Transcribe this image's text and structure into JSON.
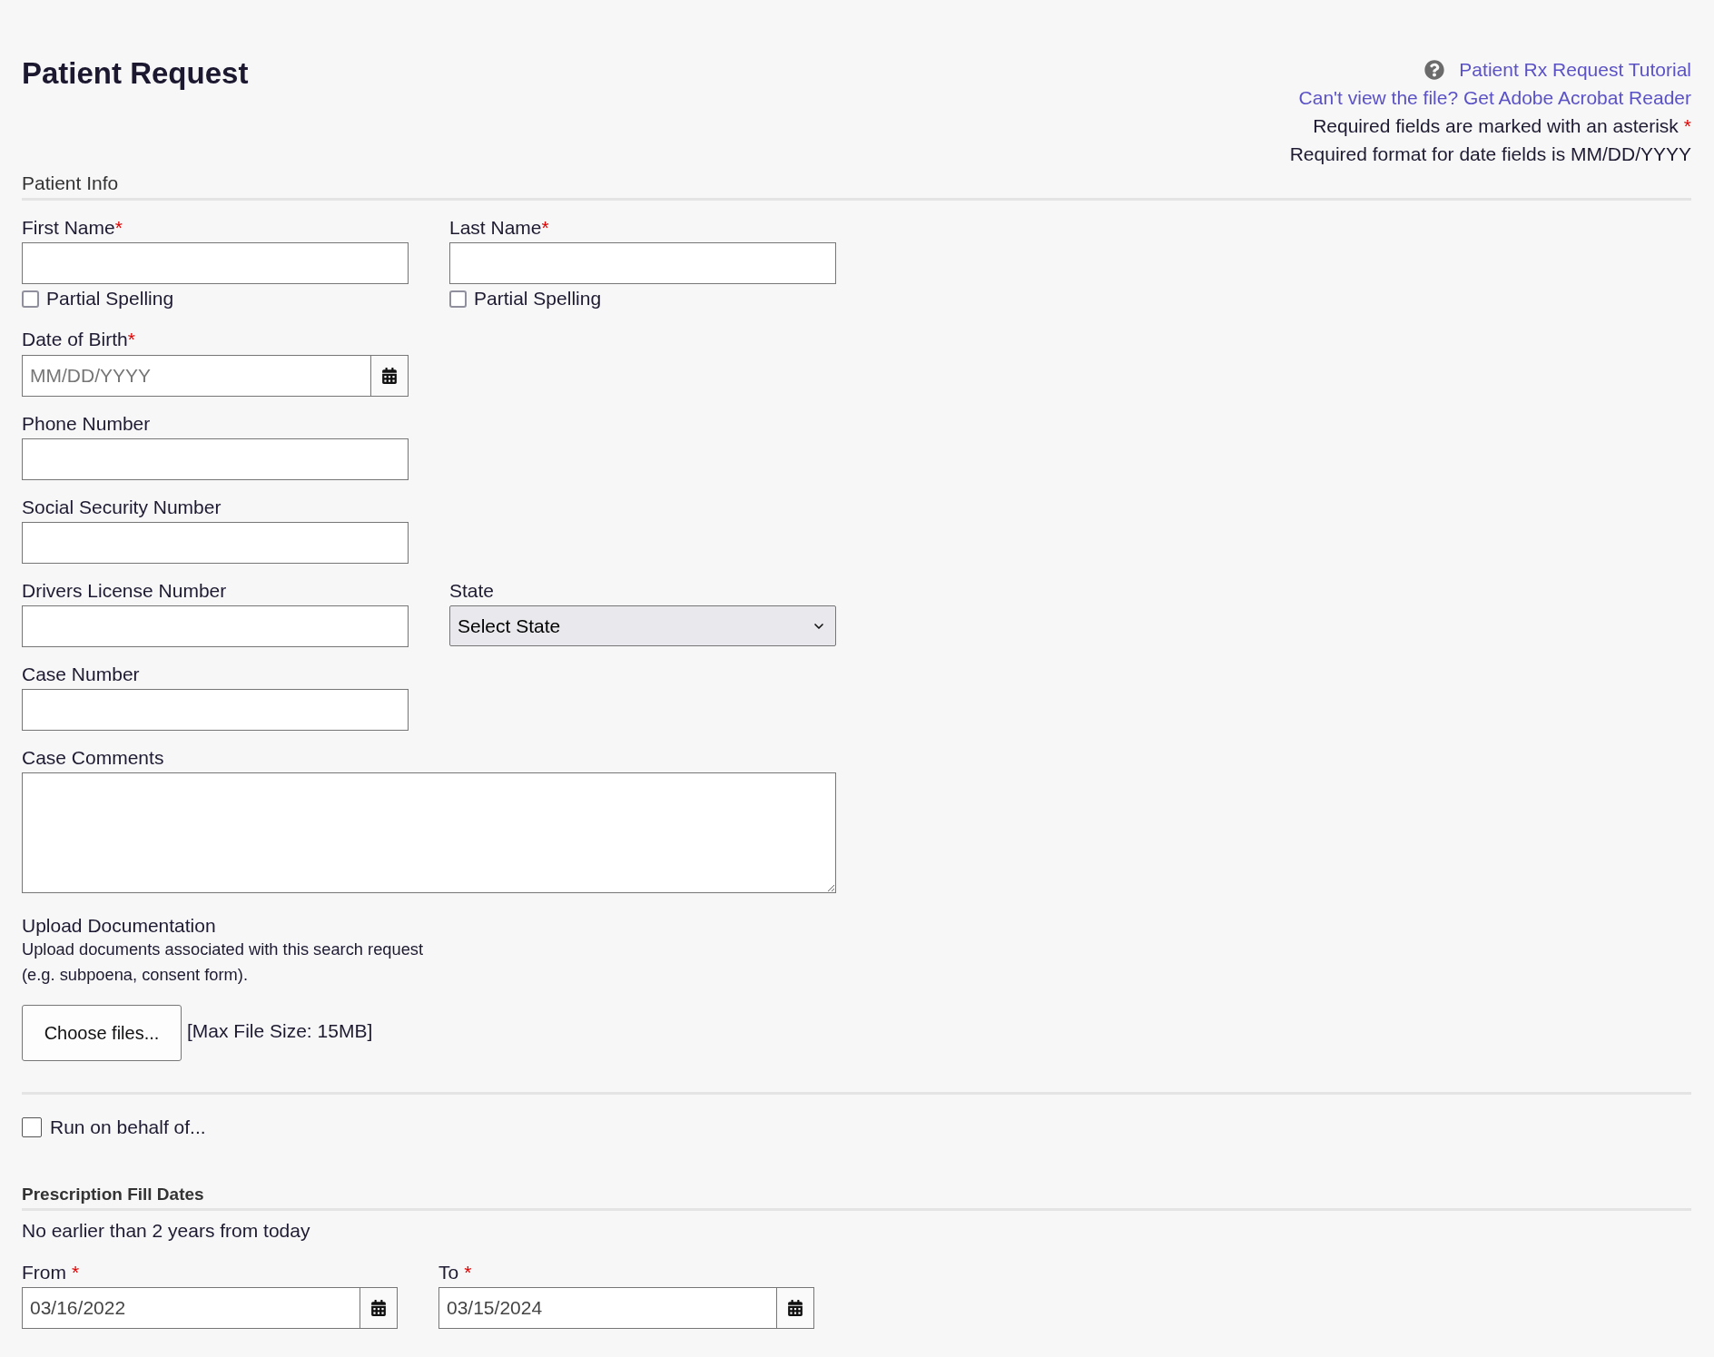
{
  "page_title": "Patient Request",
  "header_links": [
    {
      "text": "Patient Rx Request Tutorial",
      "help_icon": true
    },
    {
      "text": "Can't view the file? Get Adobe Acrobat Reader",
      "help_icon": false
    }
  ],
  "header_notes": [
    {
      "text": "Required fields are marked with an asterisk",
      "required_mark": "*"
    },
    {
      "text": "Required format for date fields is MM/DD/YYYY"
    }
  ],
  "patient_info": {
    "title": "Patient Info",
    "rows": [
      {
        "fields": [
          {
            "kind": "text",
            "label": "First Name",
            "required_mark": "*",
            "partial_spelling": {
              "label": "Partial Spelling",
              "checked": false
            }
          },
          {
            "kind": "text",
            "label": "Last Name",
            "required_mark": "*",
            "partial_spelling": {
              "label": "Partial Spelling",
              "checked": false
            }
          }
        ]
      },
      {
        "fields": [
          {
            "kind": "date",
            "label": "Date of Birth",
            "required_mark": "*",
            "placeholder": "MM/DD/YYYY"
          }
        ]
      },
      {
        "fields": [
          {
            "kind": "text",
            "label": "Phone Number"
          }
        ]
      },
      {
        "fields": [
          {
            "kind": "text",
            "label": "Social Security Number"
          }
        ]
      },
      {
        "fields": [
          {
            "kind": "text",
            "label": "Drivers License Number"
          },
          {
            "kind": "select",
            "label": "State",
            "value": "Select State"
          }
        ]
      },
      {
        "fields": [
          {
            "kind": "text",
            "label": "Case Number"
          }
        ]
      },
      {
        "fields": [
          {
            "kind": "textarea",
            "label": "Case Comments"
          }
        ]
      }
    ]
  },
  "upload": {
    "title": "Upload Documentation",
    "description": "Upload documents associated with this search request (e.g. subpoena, consent form).",
    "button": "Choose files...",
    "max_size": "[Max File Size: 15MB]"
  },
  "run_on_behalf": {
    "label": "Run on behalf of...",
    "checked": false
  },
  "prescription_fill_dates": {
    "title": "Prescription Fill Dates",
    "note": "No earlier than 2 years from today",
    "fields": [
      {
        "label": "From",
        "required_mark": "*",
        "value": "03/16/2022"
      },
      {
        "label": "To",
        "required_mark": "*",
        "value": "03/15/2024"
      }
    ]
  }
}
